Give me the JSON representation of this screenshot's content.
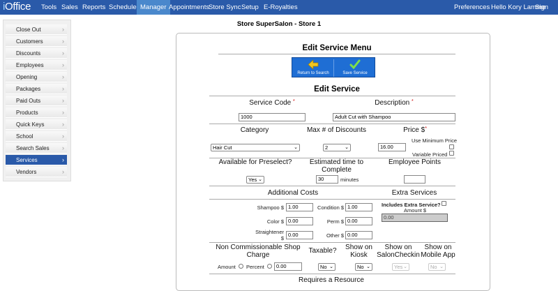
{
  "app": {
    "logo_prefix": "i",
    "logo_rest": "Office"
  },
  "nav": {
    "items": [
      "Tools",
      "Sales",
      "Reports",
      "Scheduler",
      "Manager",
      "Appointments",
      "Store Sync",
      "Setup",
      "E-Royalties"
    ],
    "active": "Manager",
    "preferences": "Preferences",
    "greeting": "Hello Kory Lamme",
    "signout": "Sign out"
  },
  "sidebar": {
    "items": [
      "Close Out",
      "Customers",
      "Discounts",
      "Employees",
      "Opening",
      "Packages",
      "Paid Outs",
      "Products",
      "Quick Keys",
      "School",
      "Search Sales",
      "Services",
      "Vendors"
    ],
    "active": "Services"
  },
  "store_title": "Store SuperSalon - Store 1",
  "menu": {
    "title": "Edit Service Menu",
    "return_label": "Return to Search",
    "save_label": "Save Service"
  },
  "form": {
    "title": "Edit Service",
    "service_code_label": "Service Code",
    "service_code": "1000",
    "description_label": "Description",
    "description": "Adult Cut with Shampoo",
    "required_mark": "*",
    "category_label": "Category",
    "category": "Hair Cut",
    "max_discounts_label": "Max # of Discounts",
    "max_discounts": "2",
    "price_label": "Price $",
    "price": "16.00",
    "use_min_price_label": "Use Minimum Price",
    "variable_priced_label": "Variable Priced",
    "preselect_label": "Available for Preselect?",
    "preselect": "Yes",
    "est_time_label_1": "Estimated time to",
    "est_time_label_2": "Complete",
    "est_time": "30",
    "minutes_label": "minutes",
    "employee_points_label": "Employee Points",
    "employee_points": "",
    "additional_costs_label": "Additional Costs",
    "shampoo_label": "Shampoo $",
    "shampoo": "1.00",
    "condition_label": "Condition $",
    "condition": "1.00",
    "color_label": "Color $",
    "color": "0.00",
    "perm_label": "Perm $",
    "perm": "0.00",
    "straightener_label_1": "Straightener",
    "straightener_label_2": "$",
    "straightener": "0.00",
    "other_label": "Other $",
    "other": "0.00",
    "extra_services_label": "Extra Services",
    "includes_extra_label": "Includes Extra Service?",
    "extra_amount_label": "Amount $",
    "extra_amount": "0.00",
    "noncomm_label_1": "Non Commissionable Shop",
    "noncomm_label_2": "Charge",
    "amount_label": "Amount",
    "percent_label": "Percent",
    "noncomm_value": "0.00",
    "taxable_label": "Taxable?",
    "taxable": "No",
    "kiosk_label_1": "Show on",
    "kiosk_label_2": "Kiosk",
    "kiosk": "No",
    "salon_label_1": "Show on",
    "salon_label_2": "SalonCheckin",
    "salon": "Yes",
    "mobile_label_1": "Show on",
    "mobile_label_2": "Mobile App",
    "mobile": "No",
    "requires_resource_label": "Requires a Resource"
  }
}
